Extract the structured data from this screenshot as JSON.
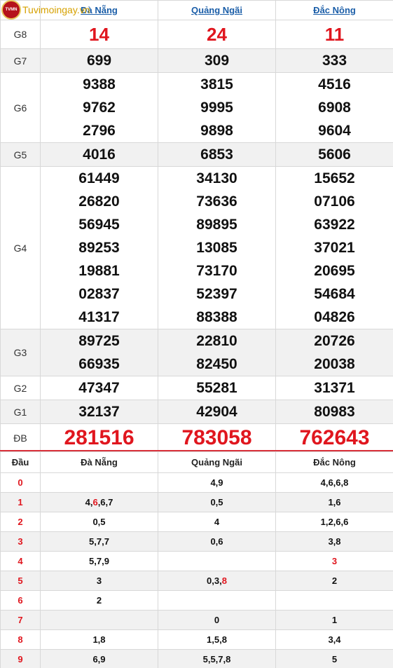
{
  "logo": {
    "badge_text": "TVMN",
    "text": "Tuvimoingay.vn"
  },
  "provinces": [
    "Đà Nẵng",
    "Quảng Ngãi",
    "Đắc Nông"
  ],
  "prizes": [
    {
      "label": "G8",
      "values": [
        [
          "14"
        ],
        [
          "24"
        ],
        [
          "11"
        ]
      ]
    },
    {
      "label": "G7",
      "values": [
        [
          "699"
        ],
        [
          "309"
        ],
        [
          "333"
        ]
      ]
    },
    {
      "label": "G6",
      "values": [
        [
          "9388",
          "9762",
          "2796"
        ],
        [
          "3815",
          "9995",
          "9898"
        ],
        [
          "4516",
          "6908",
          "9604"
        ]
      ]
    },
    {
      "label": "G5",
      "values": [
        [
          "4016"
        ],
        [
          "6853"
        ],
        [
          "5606"
        ]
      ]
    },
    {
      "label": "G4",
      "values": [
        [
          "61449",
          "26820",
          "56945",
          "89253",
          "19881",
          "02837",
          "41317"
        ],
        [
          "34130",
          "73636",
          "89895",
          "13085",
          "73170",
          "52397",
          "88388"
        ],
        [
          "15652",
          "07106",
          "63922",
          "37021",
          "20695",
          "54684",
          "04826"
        ]
      ]
    },
    {
      "label": "G3",
      "values": [
        [
          "89725",
          "66935"
        ],
        [
          "22810",
          "82450"
        ],
        [
          "20726",
          "20038"
        ]
      ]
    },
    {
      "label": "G2",
      "values": [
        [
          "47347"
        ],
        [
          "55281"
        ],
        [
          "31371"
        ]
      ]
    },
    {
      "label": "G1",
      "values": [
        [
          "32137"
        ],
        [
          "42904"
        ],
        [
          "80983"
        ]
      ]
    },
    {
      "label": "ĐB",
      "values": [
        [
          "281516"
        ],
        [
          "783058"
        ],
        [
          "762643"
        ]
      ]
    }
  ],
  "loto": {
    "header": "Đầu",
    "provinces": [
      "Đà Nẵng",
      "Quảng Ngãi",
      "Đắc Nông"
    ],
    "rows": [
      {
        "dau": "0",
        "cells": [
          [],
          [
            {
              "t": "4,9"
            }
          ],
          [
            {
              "t": "4,6,6,8"
            }
          ]
        ]
      },
      {
        "dau": "1",
        "cells": [
          [
            {
              "t": "4,"
            },
            {
              "t": "6",
              "red": true
            },
            {
              "t": ",6,7"
            }
          ],
          [
            {
              "t": "0,5"
            }
          ],
          [
            {
              "t": "1,6"
            }
          ]
        ]
      },
      {
        "dau": "2",
        "cells": [
          [
            {
              "t": "0,5"
            }
          ],
          [
            {
              "t": "4"
            }
          ],
          [
            {
              "t": "1,2,6,6"
            }
          ]
        ]
      },
      {
        "dau": "3",
        "cells": [
          [
            {
              "t": "5,7,7"
            }
          ],
          [
            {
              "t": "0,6"
            }
          ],
          [
            {
              "t": "3,8"
            }
          ]
        ]
      },
      {
        "dau": "4",
        "cells": [
          [
            {
              "t": "5,7,9"
            }
          ],
          [],
          [
            {
              "t": "3",
              "red": true
            }
          ]
        ]
      },
      {
        "dau": "5",
        "cells": [
          [
            {
              "t": "3"
            }
          ],
          [
            {
              "t": "0,3,"
            },
            {
              "t": "8",
              "red": true
            }
          ],
          [
            {
              "t": "2"
            }
          ]
        ]
      },
      {
        "dau": "6",
        "cells": [
          [
            {
              "t": "2"
            }
          ],
          [],
          []
        ]
      },
      {
        "dau": "7",
        "cells": [
          [],
          [
            {
              "t": "0"
            }
          ],
          [
            {
              "t": "1"
            }
          ]
        ]
      },
      {
        "dau": "8",
        "cells": [
          [
            {
              "t": "1,8"
            }
          ],
          [
            {
              "t": "1,5,8"
            }
          ],
          [
            {
              "t": "3,4"
            }
          ]
        ]
      },
      {
        "dau": "9",
        "cells": [
          [
            {
              "t": "6,9"
            }
          ],
          [
            {
              "t": "5,5,7,8"
            }
          ],
          [
            {
              "t": "5"
            }
          ]
        ]
      }
    ]
  }
}
